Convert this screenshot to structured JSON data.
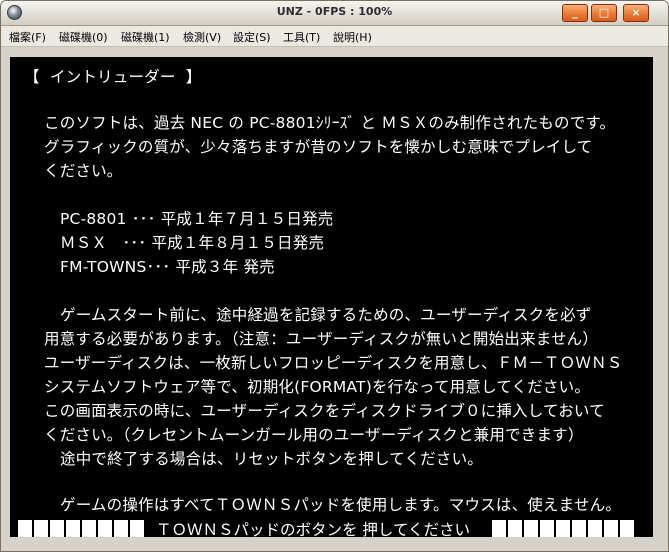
{
  "window": {
    "title": "UNZ - 0FPS : 100%",
    "buttons": {
      "minimize": "_",
      "maximize": "□",
      "close": "×"
    }
  },
  "menubar": {
    "items": [
      {
        "label": "檔案(F)"
      },
      {
        "label": "磁碟機(0)"
      },
      {
        "label": "磁碟機(1)"
      },
      {
        "label": "檢測(V)"
      },
      {
        "label": "設定(S)"
      },
      {
        "label": "工具(T)"
      },
      {
        "label": "說明(H)"
      }
    ]
  },
  "screen": {
    "heading": "【  イントリューダー  】",
    "lines": [
      "このソフトは、過去 NEC の PC-8801ｼﾘｰｽﾞ と ＭＳＸのみ制作されたものです。",
      "グラフィックの質が、少々落ちますが昔のソフトを懐かしむ意味でプレイして",
      "ください。",
      "PC-8801 ･･･ 平成１年７月１５日発売",
      "ＭＳＸ   ･･･ 平成１年８月１５日発売",
      "FM-TOWNS･･･ 平成３年 発売",
      "ゲームスタート前に、途中経過を記録するための、ユーザーディスクを必ず",
      "用意する必要があります。（注意：ユーザーディスクが無いと開始出来ません）",
      "ユーザーディスクは、一枚新しいフロッピーディスクを用意し、ＦＭ－ＴＯＷＮＳ",
      "システムソフトウェア等で、初期化(FORMAT)を行なって用意してください。",
      "この画面表示の時に、ユーザーディスクをディスクドライブ０に挿入しておいて",
      "ください。（クレセントムーンガール用のユーザーディスクと兼用できます）",
      "途中で終了する場合は、リセットボタンを押してください。",
      "ゲームの操作はすべてＴＯＷＮＳパッドを使用します。マウスは、使えません。"
    ],
    "prompt": "ＴＯＷＮＳパッドのボタンを 押してください"
  }
}
